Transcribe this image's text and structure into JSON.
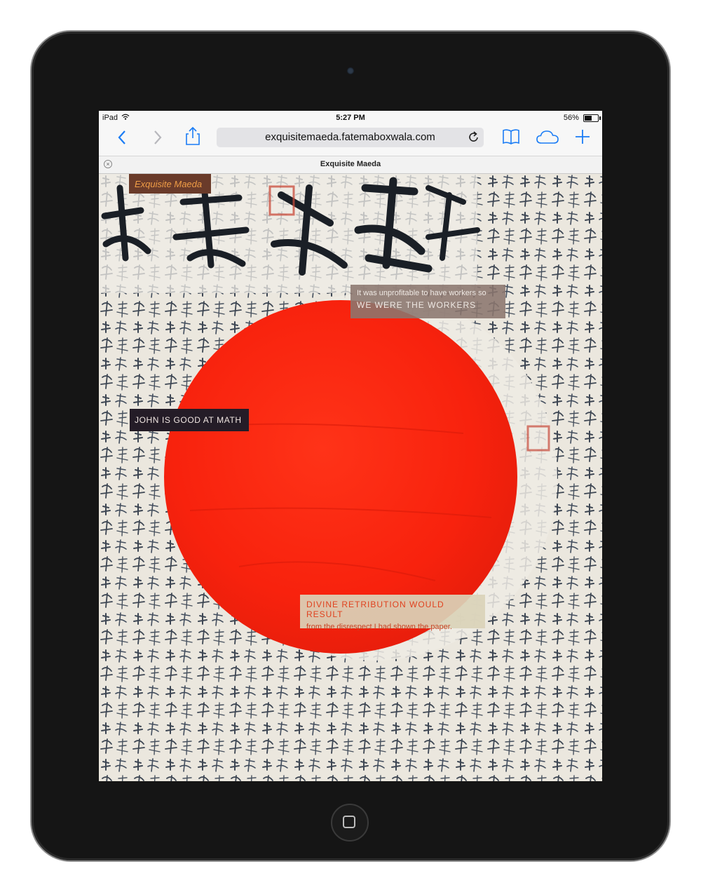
{
  "status_bar": {
    "device": "iPad",
    "time": "5:27 PM",
    "battery": "56%",
    "battery_level": 0.56
  },
  "toolbar": {
    "back_icon": "chevron-left-icon",
    "forward_icon": "chevron-right-icon",
    "share_icon": "share-icon",
    "url": "exquisitemaeda.fatemaboxwala.com",
    "reload_icon": "reload-icon",
    "bookmarks_icon": "book-icon",
    "cloud_icon": "cloud-icon",
    "new_tab_icon": "plus-icon",
    "accent_color": "#1a7cf5"
  },
  "tab": {
    "title": "Exquisite Maeda"
  },
  "page": {
    "brand": "Exquisite Maeda",
    "box_workers": {
      "line1": "It was unprofitable to have workers so",
      "line2": "WE WERE THE WORKERS"
    },
    "box_math": "JOHN IS GOOD AT MATH",
    "box_divine": {
      "line1": "DIVINE RETRIBUTION WOULD RESULT",
      "line2": "from the disrespect I had shown the paper."
    },
    "background": "Japanese flag with red sun (#ff2a10) surrounded by handwritten calligraphy"
  }
}
